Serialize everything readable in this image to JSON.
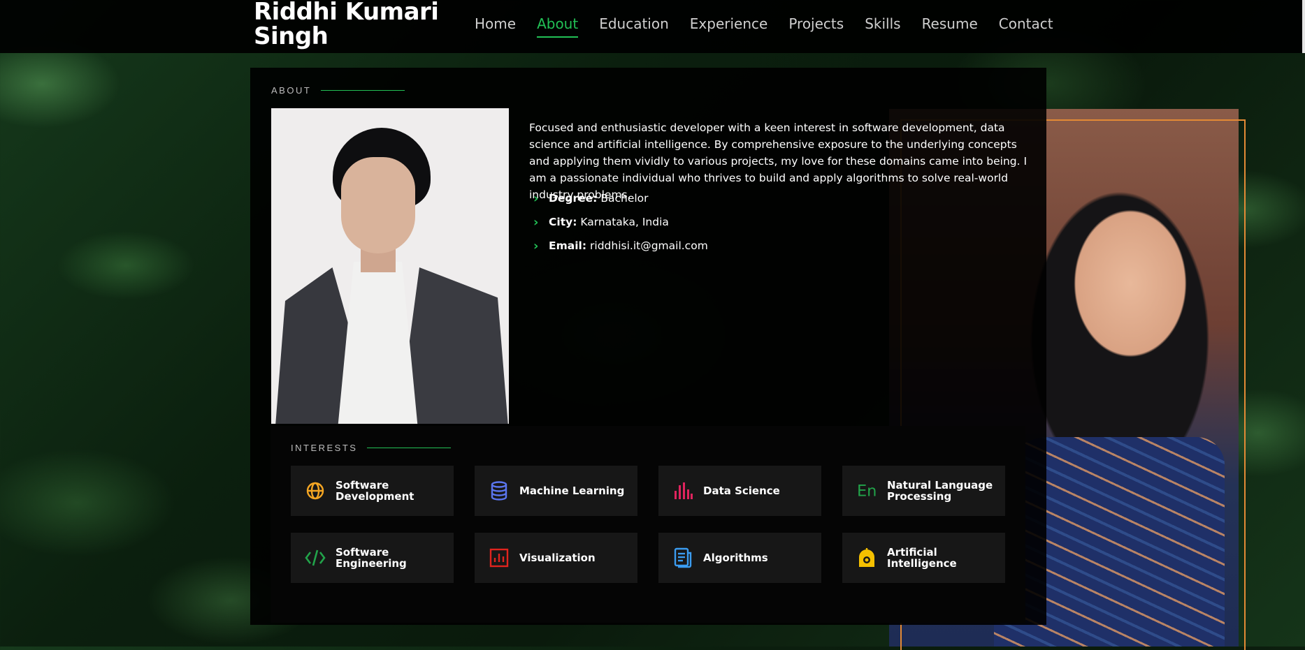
{
  "header": {
    "logo_line1": "Riddhi Kumari",
    "logo_line2": "Singh",
    "nav": [
      {
        "label": "Home",
        "active": false
      },
      {
        "label": "About",
        "active": true
      },
      {
        "label": "Education",
        "active": false
      },
      {
        "label": "Experience",
        "active": false
      },
      {
        "label": "Projects",
        "active": false
      },
      {
        "label": "Skills",
        "active": false
      },
      {
        "label": "Resume",
        "active": false
      },
      {
        "label": "Contact",
        "active": false
      }
    ]
  },
  "about": {
    "title": "ABOUT",
    "description": "Focused and enthusiastic developer with a keen interest in software development, data science and artificial intelligence. By comprehensive exposure to the underlying concepts and applying them vividly to various projects, my love for these domains came into being. I am a passionate individual who thrives to build and apply algorithms to solve real-world industry problems.",
    "facts": [
      {
        "label": "Degree:",
        "value": "Bachelor"
      },
      {
        "label": "City:",
        "value": "Karnataka, India"
      },
      {
        "label": "Email:",
        "value": "riddhisi.it@gmail.com"
      }
    ]
  },
  "interests": {
    "title": "INTERESTS",
    "items": [
      {
        "label_line1": "Software",
        "label_line2": "Development",
        "icon": "globe-icon",
        "color": "#f5a623"
      },
      {
        "label_line1": "Machine Learning",
        "label_line2": "",
        "icon": "database-icon",
        "color": "#5b76f0"
      },
      {
        "label_line1": "Data Science",
        "label_line2": "",
        "icon": "bar-chart-icon",
        "color": "#e0245e"
      },
      {
        "label_line1": "Natural Language",
        "label_line2": "Processing",
        "icon": "language-icon",
        "color": "#22a34a"
      },
      {
        "label_line1": "Software",
        "label_line2": "Engineering",
        "icon": "code-icon",
        "color": "#22a34a"
      },
      {
        "label_line1": "Visualization",
        "label_line2": "",
        "icon": "chart-box-icon",
        "color": "#e0241e"
      },
      {
        "label_line1": "Algorithms",
        "label_line2": "",
        "icon": "document-icon",
        "color": "#3b9cf0"
      },
      {
        "label_line1": "Artificial",
        "label_line2": "Intelligence",
        "icon": "robot-icon",
        "color": "#f5c000"
      }
    ]
  },
  "colors": {
    "accent": "#22c055",
    "frame": "#e38a35"
  }
}
